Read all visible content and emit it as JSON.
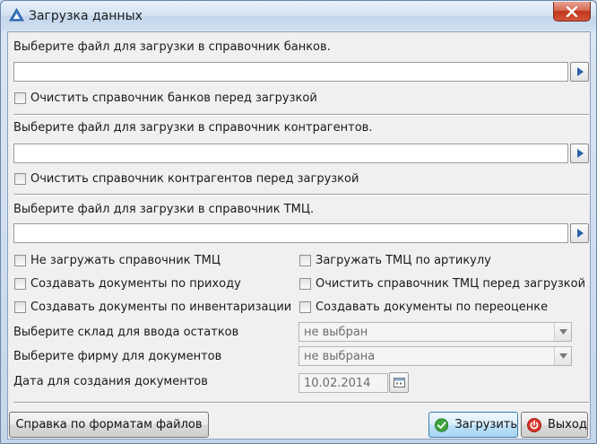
{
  "window": {
    "title": "Загрузка данных",
    "close_label": "✕"
  },
  "banks": {
    "label": "Выберите файл для загрузки в справочник банков.",
    "file_value": "",
    "clear_label": "Очистить справочник банков перед загрузкой",
    "clear_checked": false
  },
  "contractors": {
    "label": "Выберите файл для загрузки в справочник контрагентов.",
    "file_value": "",
    "clear_label": "Очистить справочник контрагентов перед загрузкой",
    "clear_checked": false
  },
  "tmc": {
    "label": "Выберите файл для загрузки в справочник ТМЦ.",
    "file_value": "",
    "options": {
      "no_load": "Не загружать справочник ТМЦ",
      "by_article": "Загружать ТМЦ по артикулу",
      "create_receipt": "Создавать документы по приходу",
      "clear_before": "Очистить справочник ТМЦ перед загрузкой",
      "create_inventory": "Создавать документы по инвентаризации",
      "create_revaluation": "Создавать документы по переоценке"
    }
  },
  "warehouse": {
    "label": "Выберите склад для ввода остатков",
    "value": "не выбран"
  },
  "firm": {
    "label": "Выберите фирму для документов",
    "value": "не выбрана"
  },
  "date": {
    "label": "Дата для создания документов",
    "value": "10.02.2014"
  },
  "buttons": {
    "help": "Справка по форматам файлов",
    "load": "Загрузить",
    "exit": "Выход"
  },
  "colors": {
    "accent_close": "#c2361c",
    "load_icon": "#3da33d",
    "exit_icon": "#d9362b"
  }
}
